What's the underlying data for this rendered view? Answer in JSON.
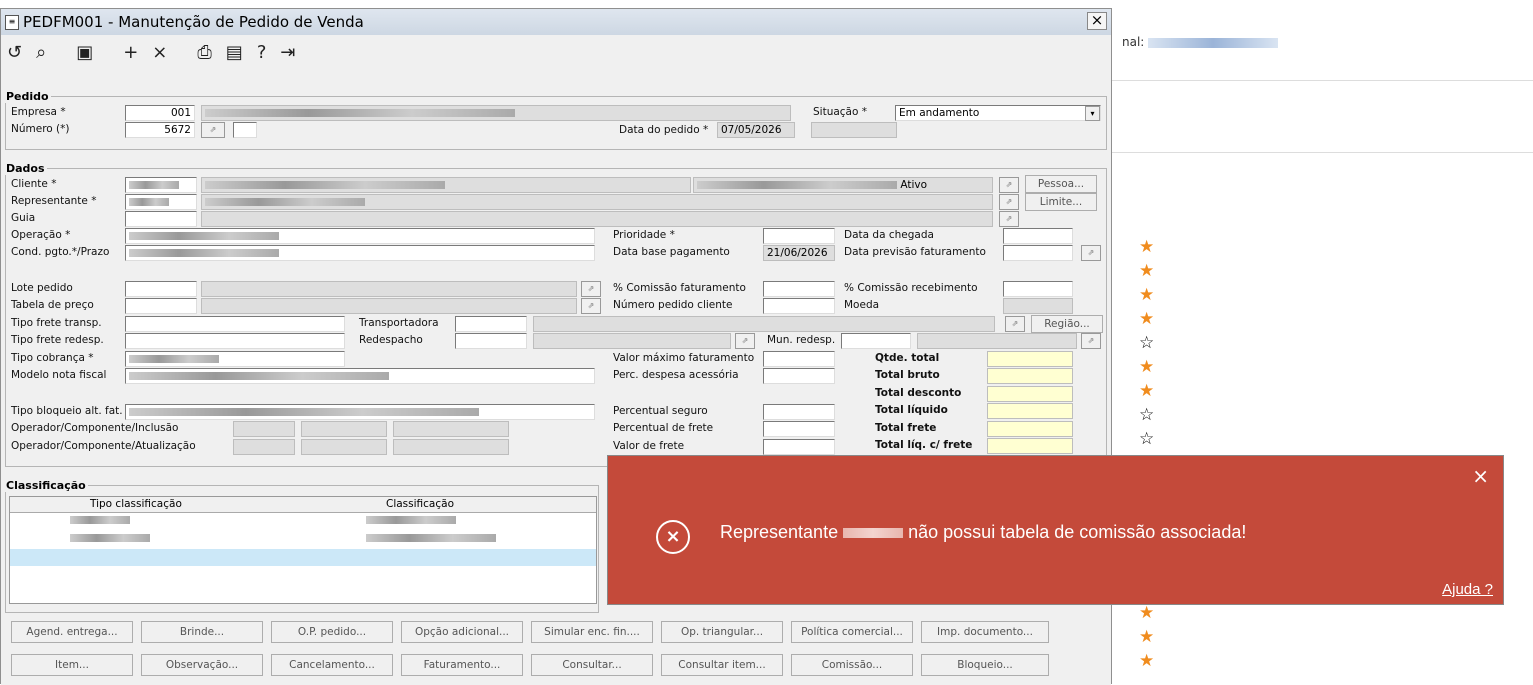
{
  "window": {
    "title": "PEDFM001 - Manutenção de Pedido de Venda",
    "close": "×"
  },
  "background": {
    "label_prefix": "nal:"
  },
  "pedido": {
    "legend": "Pedido",
    "empresa_label": "Empresa *",
    "empresa_value": "001",
    "numero_label": "Número (*)",
    "numero_value": "5672",
    "situacao_label": "Situação *",
    "situacao_value": "Em andamento",
    "data_label": "Data do pedido *",
    "data_value": "07/05/2026"
  },
  "dados": {
    "legend": "Dados",
    "cliente_label": "Cliente *",
    "cliente_status": "Ativo",
    "representante_label": "Representante *",
    "guia_label": "Guia",
    "operacao_label": "Operação *",
    "cond_label": "Cond. pgto.*/Prazo",
    "lote_label": "Lote pedido",
    "tabela_label": "Tabela de preço",
    "frete_transp_label": "Tipo frete transp.",
    "frete_redesp_label": "Tipo frete redesp.",
    "cobranca_label": "Tipo cobrança *",
    "modelo_label": "Modelo nota fiscal",
    "bloqueio_label": "Tipo bloqueio alt. fat.",
    "op_inclusao_label": "Operador/Componente/Inclusão",
    "op_atualizacao_label": "Operador/Componente/Atualização",
    "prioridade_label": "Prioridade *",
    "data_base_label": "Data base pagamento",
    "data_base_value": "21/06/2026",
    "comissao_fat_label": "% Comissão faturamento",
    "num_pedido_cliente_label": "Número pedido cliente",
    "transportadora_label": "Transportadora",
    "redespacho_label": "Redespacho",
    "mun_redesp_label": "Mun. redesp.",
    "valor_max_label": "Valor máximo faturamento",
    "perc_desp_label": "Perc. despesa acessória",
    "perc_seguro_label": "Percentual seguro",
    "perc_frete_label": "Percentual de frete",
    "valor_frete_label": "Valor de frete",
    "data_chegada_label": "Data da chegada",
    "data_prev_label": "Data previsão faturamento",
    "comissao_rec_label": "% Comissão recebimento",
    "moeda_label": "Moeda",
    "pessoa_btn": "Pessoa...",
    "limite_btn": "Limite...",
    "regiao_btn": "Região...",
    "qtde_total": "Qtde. total",
    "total_bruto": "Total bruto",
    "total_desconto": "Total desconto",
    "total_liquido": "Total líquido",
    "total_frete": "Total frete",
    "total_liq_frete": "Total líq. c/ frete"
  },
  "classificacao": {
    "legend": "Classificação",
    "col1": "Tipo classificação",
    "col2": "Classificação"
  },
  "buttons_row1": [
    "Agend. entrega...",
    "Brinde...",
    "O.P. pedido...",
    "Opção adicional...",
    "Simular enc. fin....",
    "Op. triangular...",
    "Política comercial...",
    "Imp. documento..."
  ],
  "buttons_row2": [
    "Item...",
    "Observação...",
    "Cancelamento...",
    "Faturamento...",
    "Consultar...",
    "Consultar item...",
    "Comissão...",
    "Bloqueio..."
  ],
  "toast": {
    "message_before": "Representante",
    "message_after": "não possui tabela de comissão associada!",
    "help": "Ajuda ?",
    "close": "×"
  },
  "stars": [
    "filled",
    "filled",
    "filled",
    "filled",
    "empty",
    "filled",
    "filled",
    "empty",
    "empty"
  ],
  "colors": {
    "toast_bg": "#c44a3a",
    "star": "#f08c1e",
    "totals_bg": "#ffffd2"
  }
}
